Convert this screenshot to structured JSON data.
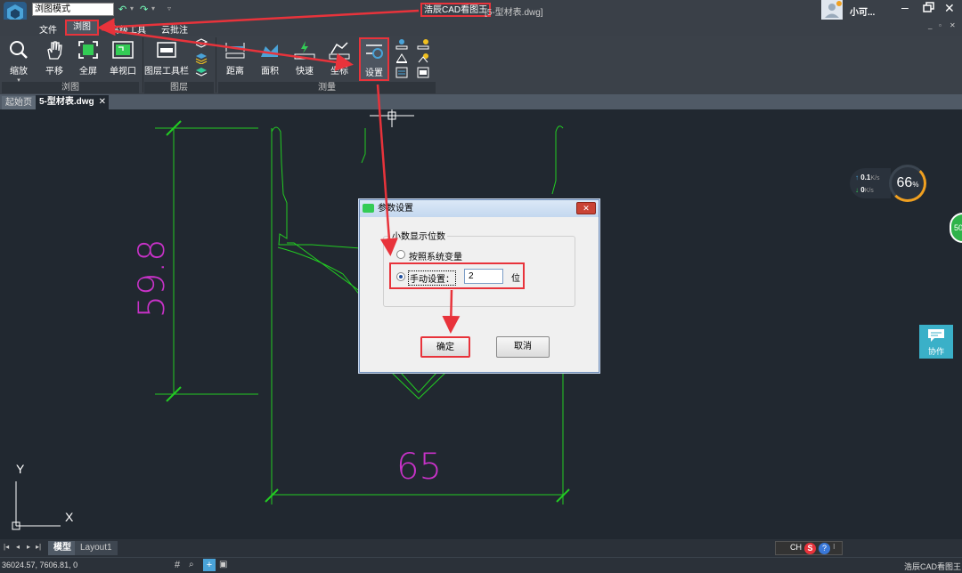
{
  "titlebar": {
    "mode_select": "浏图模式",
    "app_name": "浩辰CAD看图王",
    "file_name": "[5-型材表.dwg]",
    "username": "小可..."
  },
  "menu": {
    "items": [
      "文件",
      "浏图",
      "高级工具",
      "云批注"
    ]
  },
  "ribbon": {
    "buttons": [
      "缩放",
      "平移",
      "全屏",
      "单视口",
      "图层工具栏",
      "距离",
      "面积",
      "快速",
      "坐标",
      "设置"
    ],
    "groups": [
      "浏图",
      "图层",
      "测量"
    ]
  },
  "tabs": {
    "home": "起始页",
    "active": "5-型材表.dwg"
  },
  "drawing": {
    "dim_vertical": "59.8",
    "dim_horizontal": "65",
    "axis_y": "Y",
    "axis_x": "X"
  },
  "network_widget": {
    "up_value": "0.1",
    "up_unit": "K/s",
    "down_value": "0",
    "down_unit": "K/s",
    "percent": "66",
    "percent_sign": "%"
  },
  "side_badge": "50",
  "collab_label": "协作",
  "dialog": {
    "title": "参数设置",
    "group_label": "小数显示位数",
    "option_system": "按照系统变量",
    "option_manual": "手动设置：",
    "manual_value": "2",
    "unit": "位",
    "ok": "确定",
    "cancel": "取消"
  },
  "layout_tabs": [
    "模型",
    "Layout1"
  ],
  "status": {
    "coords": "36024.57, 7606.81, 0",
    "app_name": "浩辰CAD看图王",
    "ime": "CH"
  },
  "colors": {
    "annotation_red": "#e8333b",
    "drawing_green": "#22cc22",
    "dimension_magenta": "#c832c8",
    "canvas": "#212830"
  }
}
